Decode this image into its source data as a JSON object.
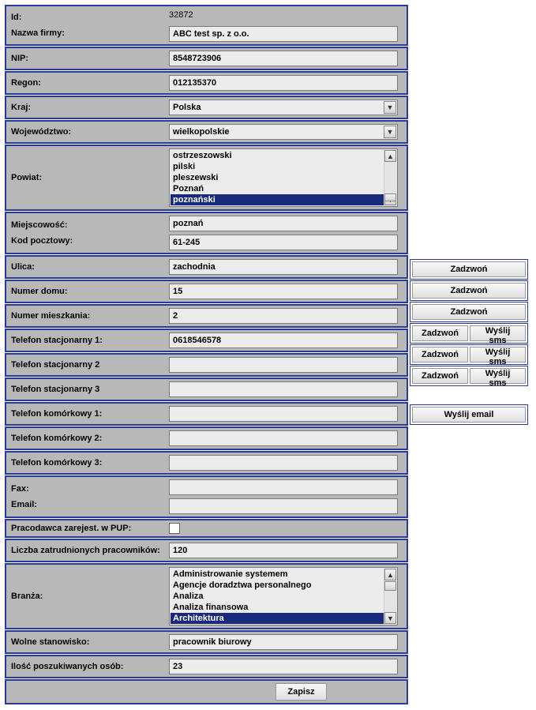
{
  "labels": {
    "id": "Id:",
    "company": "Nazwa firmy:",
    "nip": "NIP:",
    "regon": "Regon:",
    "country": "Kraj:",
    "province": "Województwo:",
    "district": "Powiat:",
    "city": "Miejscowość:",
    "postcode": "Kod pocztowy:",
    "street": "Ulica:",
    "house": "Numer domu:",
    "apt": "Numer mieszkania:",
    "phone1": "Telefon stacjonarny 1:",
    "phone2": "Telefon stacjonarny 2",
    "phone3": "Telefon stacjonarny 3",
    "mobile1": "Telefon komórkowy 1:",
    "mobile2": "Telefon komórkowy 2:",
    "mobile3": "Telefon komórkowy 3:",
    "fax": "Fax:",
    "email": "Email:",
    "pup": "Pracodawca zarejest. w PUP:",
    "employees": "Liczba zatrudnionych pracowników:",
    "industry": "Branża:",
    "vacancy": "Wolne stanowisko:",
    "seekers": "Ilość poszukiwanych osób:"
  },
  "values": {
    "id": "32872",
    "company": "ABC test sp. z o.o.",
    "nip": "8548723906",
    "regon": "012135370",
    "country": "Polska",
    "province": "wielkopolskie",
    "city": "poznań",
    "postcode": "61-245",
    "street": "zachodnia",
    "house": "15",
    "apt": "2",
    "phone1": "0618546578",
    "phone2": "",
    "phone3": "",
    "mobile1": "",
    "mobile2": "",
    "mobile3": "",
    "fax": "",
    "email": "",
    "employees": "120",
    "vacancy": "pracownik biurowy",
    "seekers": "23"
  },
  "district_options": [
    "ostrzeszowski",
    "pilski",
    "pleszewski",
    "Poznań",
    "poznański"
  ],
  "district_selected": "poznański",
  "industry_options": [
    "Administrowanie systemem",
    "Agencje doradztwa personalnego",
    "Analiza",
    "Analiza finansowa",
    "Architektura"
  ],
  "industry_selected": "Architektura",
  "buttons": {
    "call": "Zadzwoń",
    "sms": "Wyślij sms",
    "email": "Wyślij email",
    "save": "Zapisz"
  }
}
